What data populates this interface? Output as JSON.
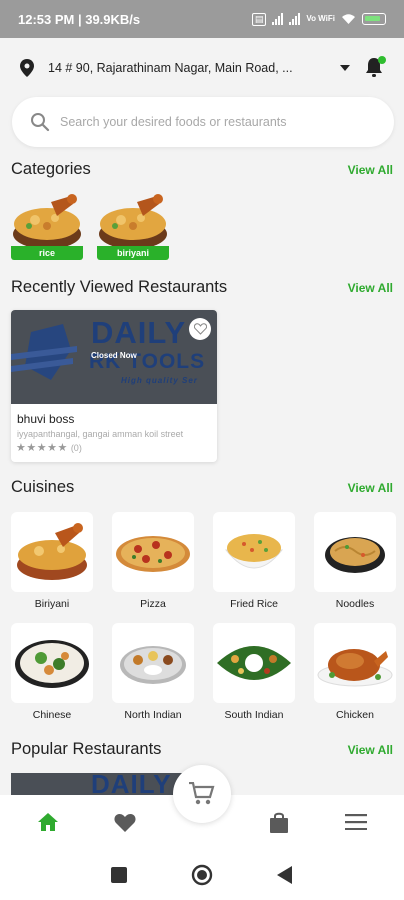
{
  "status_bar": {
    "time": "12:53 PM | 39.9KB/s",
    "network": "4G",
    "wifi_label": "Vo WiFi",
    "battery_color": "#7ee27e"
  },
  "address": {
    "text": "14 # 90, Rajarathinam Nagar, Main Road, ..."
  },
  "search": {
    "placeholder": "Search your desired foods or restaurants"
  },
  "accent_color": "#2faa2f",
  "categories": {
    "title": "Categories",
    "view_all": "View All",
    "items": [
      {
        "label": "rice",
        "icon": "biryani-bowl-icon"
      },
      {
        "label": "biriyani",
        "icon": "biryani-bowl-icon"
      }
    ]
  },
  "recently_viewed": {
    "title": "Recently Viewed Restaurants",
    "view_all": "View All",
    "restaurants": [
      {
        "banner_line1": "DAILY",
        "banner_line2": "RK TOOLS",
        "banner_line3": "High quality Ser",
        "status": "Closed Now",
        "name": "bhuvi boss",
        "address": "iyyapanthangal, gangai amman koil street",
        "rating_stars": "★★★★★",
        "rating_count": "(0)"
      }
    ]
  },
  "cuisines": {
    "title": "Cuisines",
    "view_all": "View All",
    "items": [
      {
        "label": "Biriyani",
        "icon": "biryani-icon"
      },
      {
        "label": "Pizza",
        "icon": "pizza-icon"
      },
      {
        "label": "Fried Rice",
        "icon": "fried-rice-icon"
      },
      {
        "label": "Noodles",
        "icon": "noodles-icon"
      },
      {
        "label": "Chinese",
        "icon": "chinese-icon"
      },
      {
        "label": "North Indian",
        "icon": "thali-icon"
      },
      {
        "label": "South Indian",
        "icon": "banana-leaf-meal-icon"
      },
      {
        "label": "Chicken",
        "icon": "roast-chicken-icon"
      }
    ]
  },
  "popular": {
    "title": "Popular Restaurants",
    "view_all": "View All",
    "banner_text": "DAILY"
  },
  "bottom_nav": {
    "items": [
      "home-icon",
      "heart-icon",
      "cart-icon",
      "bag-icon",
      "menu-icon"
    ],
    "active": "home-icon"
  }
}
